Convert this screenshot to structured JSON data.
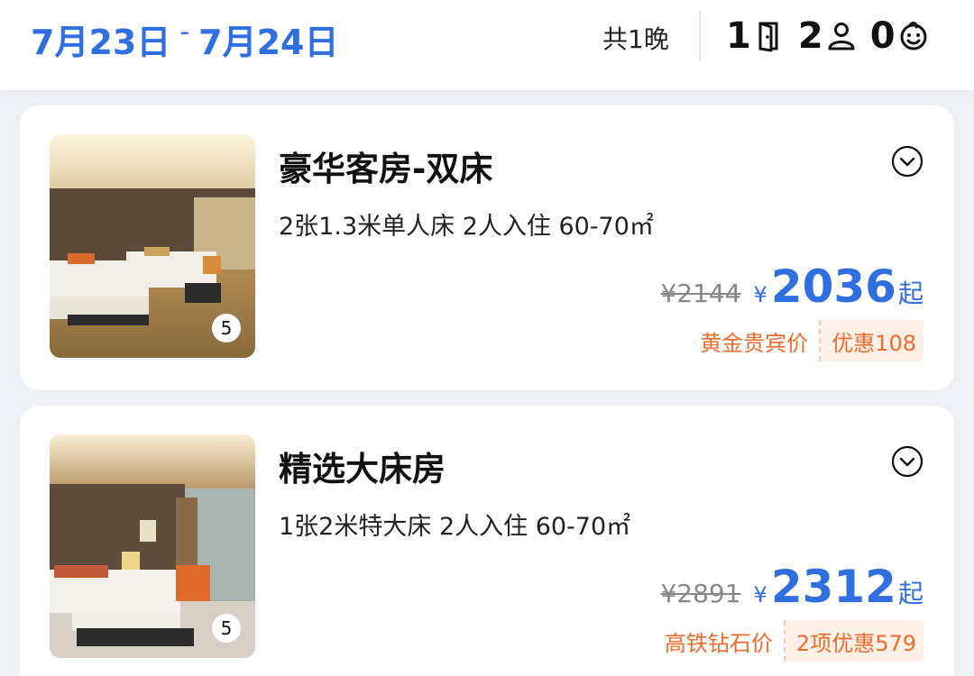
{
  "header": {
    "check_in": "7月23日",
    "separator": "-",
    "check_out": "7月24日",
    "nights": "共1晚",
    "rooms": "1",
    "adults": "2",
    "children": "0",
    "accent_color": "#2f6fe0"
  },
  "rooms": [
    {
      "name": "豪华客房-双床",
      "description": "2张1.3米单人床  2人入住  60-70㎡",
      "photo_count": "5",
      "original_price": "¥2144",
      "currency": "¥",
      "price": "2036",
      "price_suffix": "起",
      "tag_label": "黄金贵宾价",
      "tag_discount": "优惠108"
    },
    {
      "name": "精选大床房",
      "description": "1张2米特大床  2人入住  60-70㎡",
      "photo_count": "5",
      "original_price": "¥2891",
      "currency": "¥",
      "price": "2312",
      "price_suffix": "起",
      "tag_label": "高铁钻石价",
      "tag_discount": "2项优惠579"
    }
  ],
  "icons": {
    "rooms": "door-icon",
    "adults": "person-icon",
    "children": "child-face-icon",
    "expand": "chevron-down-circle-icon"
  }
}
